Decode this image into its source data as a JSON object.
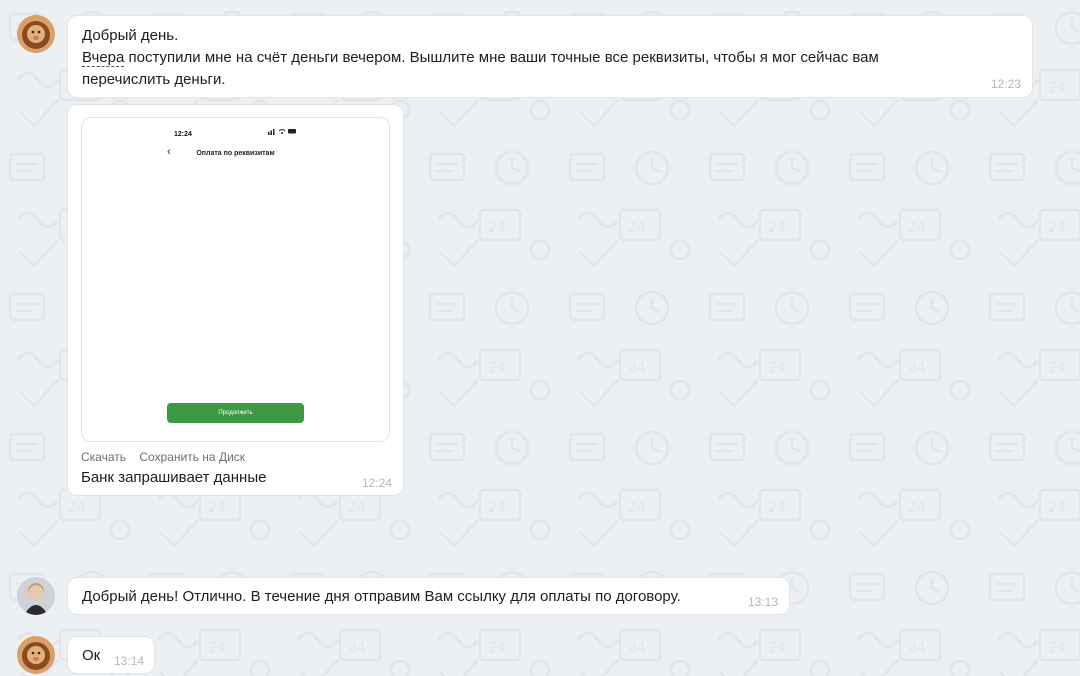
{
  "chat": {
    "messages": [
      {
        "author": "customer",
        "lines": [
          "Добрый день.",
          "Вчера",
          " поступили мне на счёт деньги вечером. Вышлите мне ваши точные все реквизиты, чтобы я мог сейчас вам",
          "перечислить деньги."
        ],
        "time": "12:23"
      },
      {
        "author": "customer",
        "attachment": {
          "phone_time": "12:24",
          "phone_status_icons": "signal-wifi-battery",
          "phone_screen_title": "Оплата по реквизитам",
          "phone_button_label": "Продолжить",
          "download_label": "Скачать",
          "save_label": "Сохранить на Диск"
        },
        "caption": "Банк запрашивает данные",
        "time": "12:24"
      },
      {
        "author": "operator",
        "text": "Добрый день! Отлично. В течение дня отправим Вам ссылку для оплаты по договору.",
        "time": "13:13"
      },
      {
        "author": "customer",
        "text": "Ок",
        "time": "13:14"
      }
    ]
  },
  "colors": {
    "background": "#edf0f3",
    "bubble": "#ffffff",
    "time_text": "#b3b8bf",
    "phone_button": "#3d9a44"
  }
}
